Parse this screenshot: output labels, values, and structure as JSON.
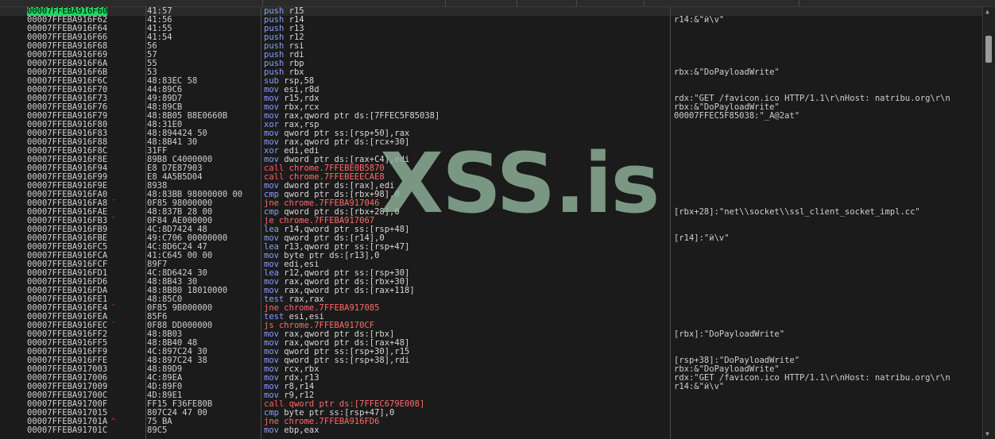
{
  "watermark": "XSS.is",
  "colors": {
    "selected_addr_bg": "#1ed760",
    "mnemonic": "#8a9cff",
    "call_jump": "#ff5a5a",
    "breakpoint": "#e03030"
  },
  "rows": [
    {
      "addr": "00007FFEBA916F60",
      "bytes": "41:57",
      "mnem": "push",
      "ops": "r15",
      "cmt": "",
      "sel": true,
      "bp": true,
      "arrow": "→"
    },
    {
      "addr": "00007FFEBA916F62",
      "bytes": "41:56",
      "mnem": "push",
      "ops": "r14",
      "cmt": "r14:&\"й\\v\""
    },
    {
      "addr": "00007FFEBA916F64",
      "bytes": "41:55",
      "mnem": "push",
      "ops": "r13",
      "cmt": ""
    },
    {
      "addr": "00007FFEBA916F66",
      "bytes": "41:54",
      "mnem": "push",
      "ops": "r12",
      "cmt": ""
    },
    {
      "addr": "00007FFEBA916F68",
      "bytes": "56",
      "mnem": "push",
      "ops": "rsi",
      "cmt": ""
    },
    {
      "addr": "00007FFEBA916F69",
      "bytes": "57",
      "mnem": "push",
      "ops": "rdi",
      "cmt": ""
    },
    {
      "addr": "00007FFEBA916F6A",
      "bytes": "55",
      "mnem": "push",
      "ops": "rbp",
      "cmt": ""
    },
    {
      "addr": "00007FFEBA916F6B",
      "bytes": "53",
      "mnem": "push",
      "ops": "rbx",
      "cmt": "rbx:&\"DoPayloadWrite\""
    },
    {
      "addr": "00007FFEBA916F6C",
      "bytes": "48:83EC 58",
      "mnem": "sub",
      "ops": "rsp,58",
      "cmt": ""
    },
    {
      "addr": "00007FFEBA916F70",
      "bytes": "44:89C6",
      "mnem": "mov",
      "ops": "esi,r8d",
      "cmt": ""
    },
    {
      "addr": "00007FFEBA916F73",
      "bytes": "49:89D7",
      "mnem": "mov",
      "ops": "r15,rdx",
      "cmt": "rdx:\"GET /favicon.ico HTTP/1.1\\r\\nHost: natribu.org\\r\\n"
    },
    {
      "addr": "00007FFEBA916F76",
      "bytes": "48:89CB",
      "mnem": "mov",
      "ops": "rbx,rcx",
      "cmt": "rbx:&\"DoPayloadWrite\""
    },
    {
      "addr": "00007FFEBA916F79",
      "bytes": "48:8B05 B8E0660B",
      "mnem": "mov",
      "ops": "rax,qword ptr ds:[7FFEC5F85038]",
      "cmt": "00007FFEC5F85038:\"_A@2at\""
    },
    {
      "addr": "00007FFEBA916F80",
      "bytes": "48:31E0",
      "mnem": "xor",
      "ops": "rax,rsp",
      "cmt": ""
    },
    {
      "addr": "00007FFEBA916F83",
      "bytes": "48:894424 50",
      "mnem": "mov",
      "ops": "qword ptr ss:[rsp+50],rax",
      "cmt": ""
    },
    {
      "addr": "00007FFEBA916F88",
      "bytes": "48:8B41 30",
      "mnem": "mov",
      "ops": "rax,qword ptr ds:[rcx+30]",
      "cmt": ""
    },
    {
      "addr": "00007FFEBA916F8C",
      "bytes": "31FF",
      "mnem": "xor",
      "ops": "edi,edi",
      "cmt": ""
    },
    {
      "addr": "00007FFEBA916F8E",
      "bytes": "89B8 C4000000",
      "mnem": "mov",
      "ops": "dword ptr ds:[rax+C4],edi",
      "cmt": ""
    },
    {
      "addr": "00007FFEBA916F94",
      "bytes": "E8 D7E87903",
      "mnem": "call",
      "ops": "chrome.7FFEBE0B5870",
      "cmt": "",
      "kind": "call"
    },
    {
      "addr": "00007FFEBA916F99",
      "bytes": "E8 4A5B5D04",
      "mnem": "call",
      "ops": "chrome.7FFEBEEECAE8",
      "cmt": "",
      "kind": "call"
    },
    {
      "addr": "00007FFEBA916F9E",
      "bytes": "8938",
      "mnem": "mov",
      "ops": "dword ptr ds:[rax],edi",
      "cmt": ""
    },
    {
      "addr": "00007FFEBA916FA0",
      "bytes": "48:83BB 98000000 00",
      "mnem": "cmp",
      "ops": "qword ptr ds:[rbx+98],0",
      "cmt": ""
    },
    {
      "addr": "00007FFEBA916FA8",
      "bytes": "0F85 98000000",
      "mnem": "jne",
      "ops": "chrome.7FFEBA917046",
      "cmt": "",
      "kind": "jmp",
      "mark": "v",
      "gut": "---•"
    },
    {
      "addr": "00007FFEBA916FAE",
      "bytes": "48:837B 28 00",
      "mnem": "cmp",
      "ops": "qword ptr ds:[rbx+28],0",
      "cmt": "[rbx+28]:\"net\\\\socket\\\\ssl_client_socket_impl.cc\""
    },
    {
      "addr": "00007FFEBA916FB3",
      "bytes": "0F84 AE000000",
      "mnem": "je",
      "ops": "chrome.7FFEBA917067",
      "cmt": "",
      "kind": "jmp",
      "mark": "v",
      "gut": "---•"
    },
    {
      "addr": "00007FFEBA916FB9",
      "bytes": "4C:8D7424 48",
      "mnem": "lea",
      "ops": "r14,qword ptr ss:[rsp+48]",
      "cmt": ""
    },
    {
      "addr": "00007FFEBA916FBE",
      "bytes": "49:C706 00000000",
      "mnem": "mov",
      "ops": "qword ptr ds:[r14],0",
      "cmt": "[r14]:\"й\\v\""
    },
    {
      "addr": "00007FFEBA916FC5",
      "bytes": "4C:8D6C24 47",
      "mnem": "lea",
      "ops": "r13,qword ptr ss:[rsp+47]",
      "cmt": ""
    },
    {
      "addr": "00007FFEBA916FCA",
      "bytes": "41:C645 00 00",
      "mnem": "mov",
      "ops": "byte ptr ds:[r13],0",
      "cmt": ""
    },
    {
      "addr": "00007FFEBA916FCF",
      "bytes": "89F7",
      "mnem": "mov",
      "ops": "edi,esi",
      "cmt": ""
    },
    {
      "addr": "00007FFEBA916FD1",
      "bytes": "4C:8D6424 30",
      "mnem": "lea",
      "ops": "r12,qword ptr ss:[rsp+30]",
      "cmt": ""
    },
    {
      "addr": "00007FFEBA916FD6",
      "bytes": "48:8B43 30",
      "mnem": "mov",
      "ops": "rax,qword ptr ds:[rbx+30]",
      "cmt": "",
      "gut": "-->•"
    },
    {
      "addr": "00007FFEBA916FDA",
      "bytes": "48:8B80 18010000",
      "mnem": "mov",
      "ops": "rax,qword ptr ds:[rax+118]",
      "cmt": ""
    },
    {
      "addr": "00007FFEBA916FE1",
      "bytes": "48:85C0",
      "mnem": "test",
      "ops": "rax,rax",
      "cmt": ""
    },
    {
      "addr": "00007FFEBA916FE4",
      "bytes": "0F85 9B000000",
      "mnem": "jne",
      "ops": "chrome.7FFEBA917085",
      "cmt": "",
      "kind": "jmp",
      "mark": "v",
      "gut": "---•"
    },
    {
      "addr": "00007FFEBA916FEA",
      "bytes": "85F6",
      "mnem": "test",
      "ops": "esi,esi",
      "cmt": ""
    },
    {
      "addr": "00007FFEBA916FEC",
      "bytes": "0F88 DD000000",
      "mnem": "js",
      "ops": "chrome.7FFEBA9170CF",
      "cmt": "",
      "kind": "jmp",
      "mark": "v",
      "gut": "---•"
    },
    {
      "addr": "00007FFEBA916FF2",
      "bytes": "48:8B03",
      "mnem": "mov",
      "ops": "rax,qword ptr ds:[rbx]",
      "cmt": "[rbx]:\"DoPayloadWrite\""
    },
    {
      "addr": "00007FFEBA916FF5",
      "bytes": "48:8B40 48",
      "mnem": "mov",
      "ops": "rax,qword ptr ds:[rax+48]",
      "cmt": ""
    },
    {
      "addr": "00007FFEBA916FF9",
      "bytes": "4C:897C24 30",
      "mnem": "mov",
      "ops": "qword ptr ss:[rsp+30],r15",
      "cmt": ""
    },
    {
      "addr": "00007FFEBA916FFE",
      "bytes": "48:897C24 38",
      "mnem": "mov",
      "ops": "qword ptr ss:[rsp+38],rdi",
      "cmt": "[rsp+38]:\"DoPayloadWrite\""
    },
    {
      "addr": "00007FFEBA917003",
      "bytes": "48:89D9",
      "mnem": "mov",
      "ops": "rcx,rbx",
      "cmt": "rbx:&\"DoPayloadWrite\""
    },
    {
      "addr": "00007FFEBA917006",
      "bytes": "4C:89EA",
      "mnem": "mov",
      "ops": "rdx,r13",
      "cmt": "rdx:\"GET /favicon.ico HTTP/1.1\\r\\nHost: natribu.org\\r\\n"
    },
    {
      "addr": "00007FFEBA917009",
      "bytes": "4D:89F0",
      "mnem": "mov",
      "ops": "r8,r14",
      "cmt": "r14:&\"й\\v\""
    },
    {
      "addr": "00007FFEBA91700C",
      "bytes": "4D:89E1",
      "mnem": "mov",
      "ops": "r9,r12",
      "cmt": ""
    },
    {
      "addr": "00007FFEBA91700F",
      "bytes": "FF15 F36FE80B",
      "mnem": "call",
      "ops": "qword ptr ds:[7FFEC679E008]",
      "cmt": "",
      "kind": "call"
    },
    {
      "addr": "00007FFEBA917015",
      "bytes": "807C24 47 00",
      "mnem": "cmp",
      "ops": "byte ptr ss:[rsp+47],0",
      "cmt": ""
    },
    {
      "addr": "00007FFEBA91701A",
      "bytes": "75 BA",
      "mnem": "jne",
      "ops": "chrome.7FFEBA916FD6",
      "cmt": "",
      "kind": "jmp",
      "mark": "^",
      "gut": "---•"
    },
    {
      "addr": "00007FFEBA91701C",
      "bytes": "89C5",
      "mnem": "mov",
      "ops": "ebp,eax",
      "cmt": ""
    }
  ]
}
